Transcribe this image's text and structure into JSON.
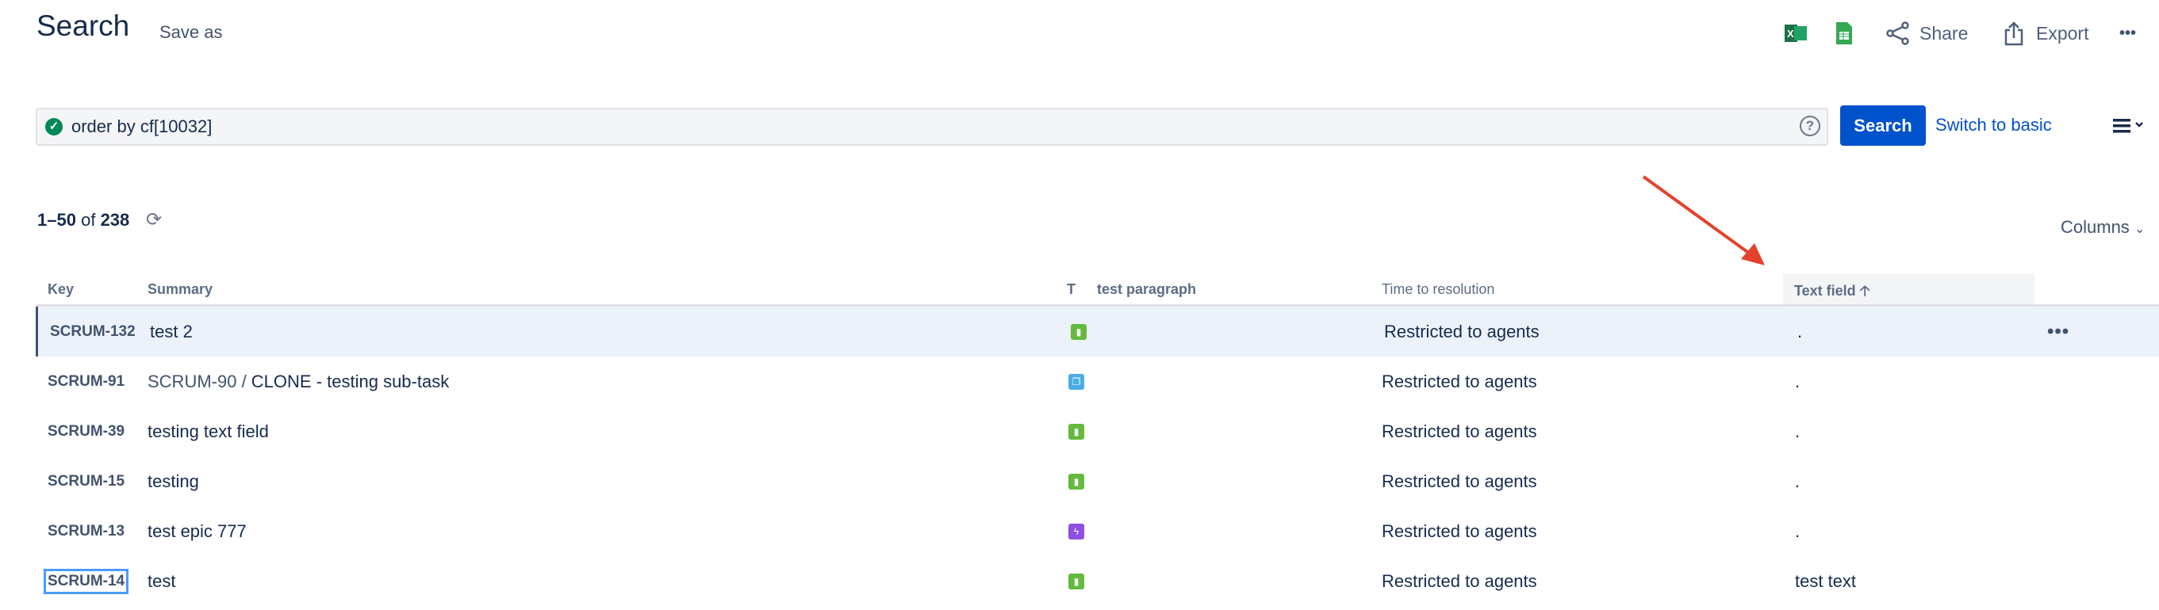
{
  "header": {
    "title": "Search",
    "save_as": "Save as",
    "share": "Share",
    "export": "Export",
    "more": "•••"
  },
  "query": {
    "value": "order by cf[10032]",
    "help": "?",
    "search_button": "Search",
    "switch_mode": "Switch to basic"
  },
  "results": {
    "range": "1–50",
    "of": "of",
    "total": "238",
    "columns_label": "Columns"
  },
  "table": {
    "headers": {
      "key": "Key",
      "summary": "Summary",
      "type": "T",
      "test_paragraph": "test paragraph",
      "time_to_resolution": "Time to resolution",
      "text_field": "Text field"
    },
    "sort_icon": "arrow-up-icon",
    "rows": [
      {
        "key": "SCRUM-132",
        "summary": "test 2",
        "parent": "",
        "type": "story",
        "time": "Restricted to agents",
        "text_field": ".",
        "more": "•••"
      },
      {
        "key": "SCRUM-91",
        "summary": "CLONE - testing sub-task",
        "parent": "SCRUM-90 / ",
        "type": "subtask",
        "time": "Restricted to agents",
        "text_field": "."
      },
      {
        "key": "SCRUM-39",
        "summary": "testing text field",
        "parent": "",
        "type": "story",
        "time": "Restricted to agents",
        "text_field": "."
      },
      {
        "key": "SCRUM-15",
        "summary": "testing",
        "parent": "",
        "type": "story",
        "time": "Restricted to agents",
        "text_field": "."
      },
      {
        "key": "SCRUM-13",
        "summary": "test epic 777",
        "parent": "",
        "type": "epic",
        "time": "Restricted to agents",
        "text_field": "."
      },
      {
        "key": "SCRUM-14",
        "summary": "test",
        "parent": "",
        "type": "story",
        "time": "Restricted to agents",
        "text_field": "test text"
      }
    ]
  },
  "colors": {
    "primary": "#0052cc",
    "story": "#63ba3c",
    "subtask": "#4bade8",
    "epic": "#904ee2",
    "annotation": "#e5412d"
  }
}
